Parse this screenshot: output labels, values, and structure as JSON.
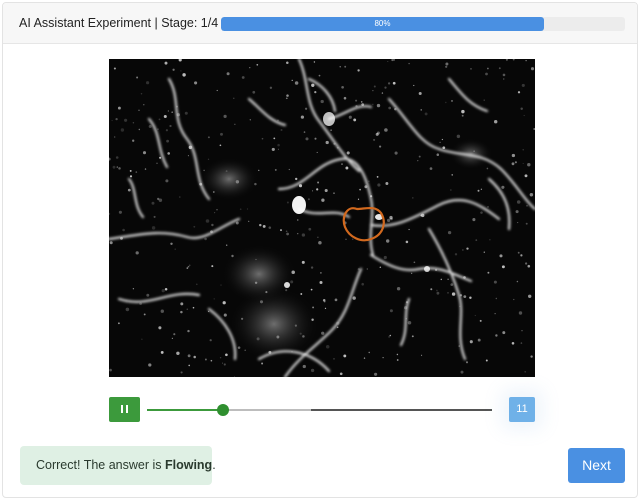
{
  "header": {
    "title": "AI Assistant Experiment | Stage: 1/4",
    "progress_value": 0.8,
    "progress_label": "80%",
    "progress_color": "#4a90e2"
  },
  "media": {
    "description_icon": "microscopy-video-frame",
    "highlight_color": "#d2691e"
  },
  "player": {
    "pause_icon": "pause-icon",
    "position": 0.22,
    "buffered": 0.475,
    "frame_label": "11",
    "accent_color": "#3c9a3c"
  },
  "feedback": {
    "prefix": "Correct! The answer is ",
    "answer": "Flowing",
    "suffix": "."
  },
  "actions": {
    "next_label": "Next"
  }
}
